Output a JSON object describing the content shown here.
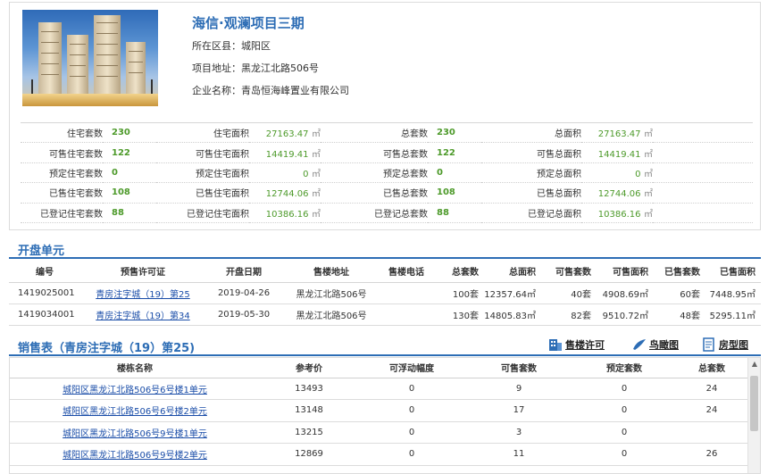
{
  "project": {
    "title": "海信·观澜项目三期",
    "district_label": "所在区县：",
    "district": "城阳区",
    "address_label": "项目地址：",
    "address": "黑龙江北路506号",
    "company_label": "企业名称：",
    "company": "青岛恒海峰置业有限公司"
  },
  "stats": [
    [
      "住宅套数",
      "230",
      "住宅面积",
      "27163.47",
      "总套数",
      "230",
      "总面积",
      "27163.47"
    ],
    [
      "可售住宅套数",
      "122",
      "可售住宅面积",
      "14419.41",
      "可售总套数",
      "122",
      "可售总面积",
      "14419.41"
    ],
    [
      "预定住宅套数",
      "0",
      "预定住宅面积",
      "0",
      "预定总套数",
      "0",
      "预定总面积",
      "0"
    ],
    [
      "已售住宅套数",
      "108",
      "已售住宅面积",
      "12744.06",
      "已售总套数",
      "108",
      "已售总面积",
      "12744.06"
    ],
    [
      "已登记住宅套数",
      "88",
      "已登记住宅面积",
      "10386.16",
      "已登记总套数",
      "88",
      "已登记总面积",
      "10386.16"
    ]
  ],
  "area_unit": "㎡",
  "open_units": {
    "title": "开盘单元",
    "headers": [
      "编号",
      "预售许可证",
      "开盘日期",
      "售楼地址",
      "售楼电话",
      "总套数",
      "总面积",
      "可售套数",
      "可售面积",
      "已售套数",
      "已售面积"
    ],
    "rows": [
      [
        "1419025001",
        "青房注字城（19）第25",
        "2019-04-26",
        "黑龙江北路506号",
        "",
        "100套",
        "12357.64㎡",
        "40套",
        "4908.69㎡",
        "60套",
        "7448.95㎡"
      ],
      [
        "1419034001",
        "青房注字城（19）第34",
        "2019-05-30",
        "黑龙江北路506号",
        "",
        "130套",
        "14805.83㎡",
        "82套",
        "9510.72㎡",
        "48套",
        "5295.11㎡"
      ]
    ]
  },
  "sales": {
    "title": "销售表（青房注字城（19）第25)",
    "tools": {
      "permit": "售楼许可",
      "aerial": "鸟瞰图",
      "floorplan": "房型图"
    },
    "headers": [
      "楼栋名称",
      "参考价",
      "可浮动幅度",
      "可售套数",
      "预定套数",
      "总套数"
    ],
    "rows": [
      [
        "城阳区黑龙江北路506号6号楼1单元",
        "13493",
        "0",
        "9",
        "0",
        "24"
      ],
      [
        "城阳区黑龙江北路506号6号楼2单元",
        "13148",
        "0",
        "17",
        "0",
        "24"
      ],
      [
        "城阳区黑龙江北路506号9号楼1单元",
        "13215",
        "0",
        "3",
        "0",
        ""
      ],
      [
        "城阳区黑龙江北路506号9号楼2单元",
        "12869",
        "0",
        "11",
        "0",
        "26"
      ]
    ]
  },
  "colors": {
    "accent": "#2d6db5",
    "value_green": "#4d9a2a",
    "link": "#1a4da8"
  },
  "icons": [
    "building-permit-icon",
    "bird-icon",
    "document-icon"
  ]
}
